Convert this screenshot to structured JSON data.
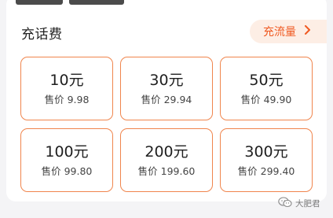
{
  "section": {
    "title": "充话费",
    "flow_button_label": "充流量",
    "flow_button_icon": "chevron-right-icon"
  },
  "tiles": [
    {
      "amount": "10元",
      "price": "售价 9.98"
    },
    {
      "amount": "30元",
      "price": "售价 29.94"
    },
    {
      "amount": "50元",
      "price": "售价 49.90"
    },
    {
      "amount": "100元",
      "price": "售价 99.80"
    },
    {
      "amount": "200元",
      "price": "售价 199.60"
    },
    {
      "amount": "300元",
      "price": "售价 299.40"
    }
  ],
  "watermark": {
    "text": "大肥君",
    "icon": "wechat-icon"
  },
  "colors": {
    "accent": "#f05a22",
    "tile_border": "#f0854d",
    "flow_button_bg": "#fdeee5",
    "page_bg": "#f4f4f6"
  }
}
